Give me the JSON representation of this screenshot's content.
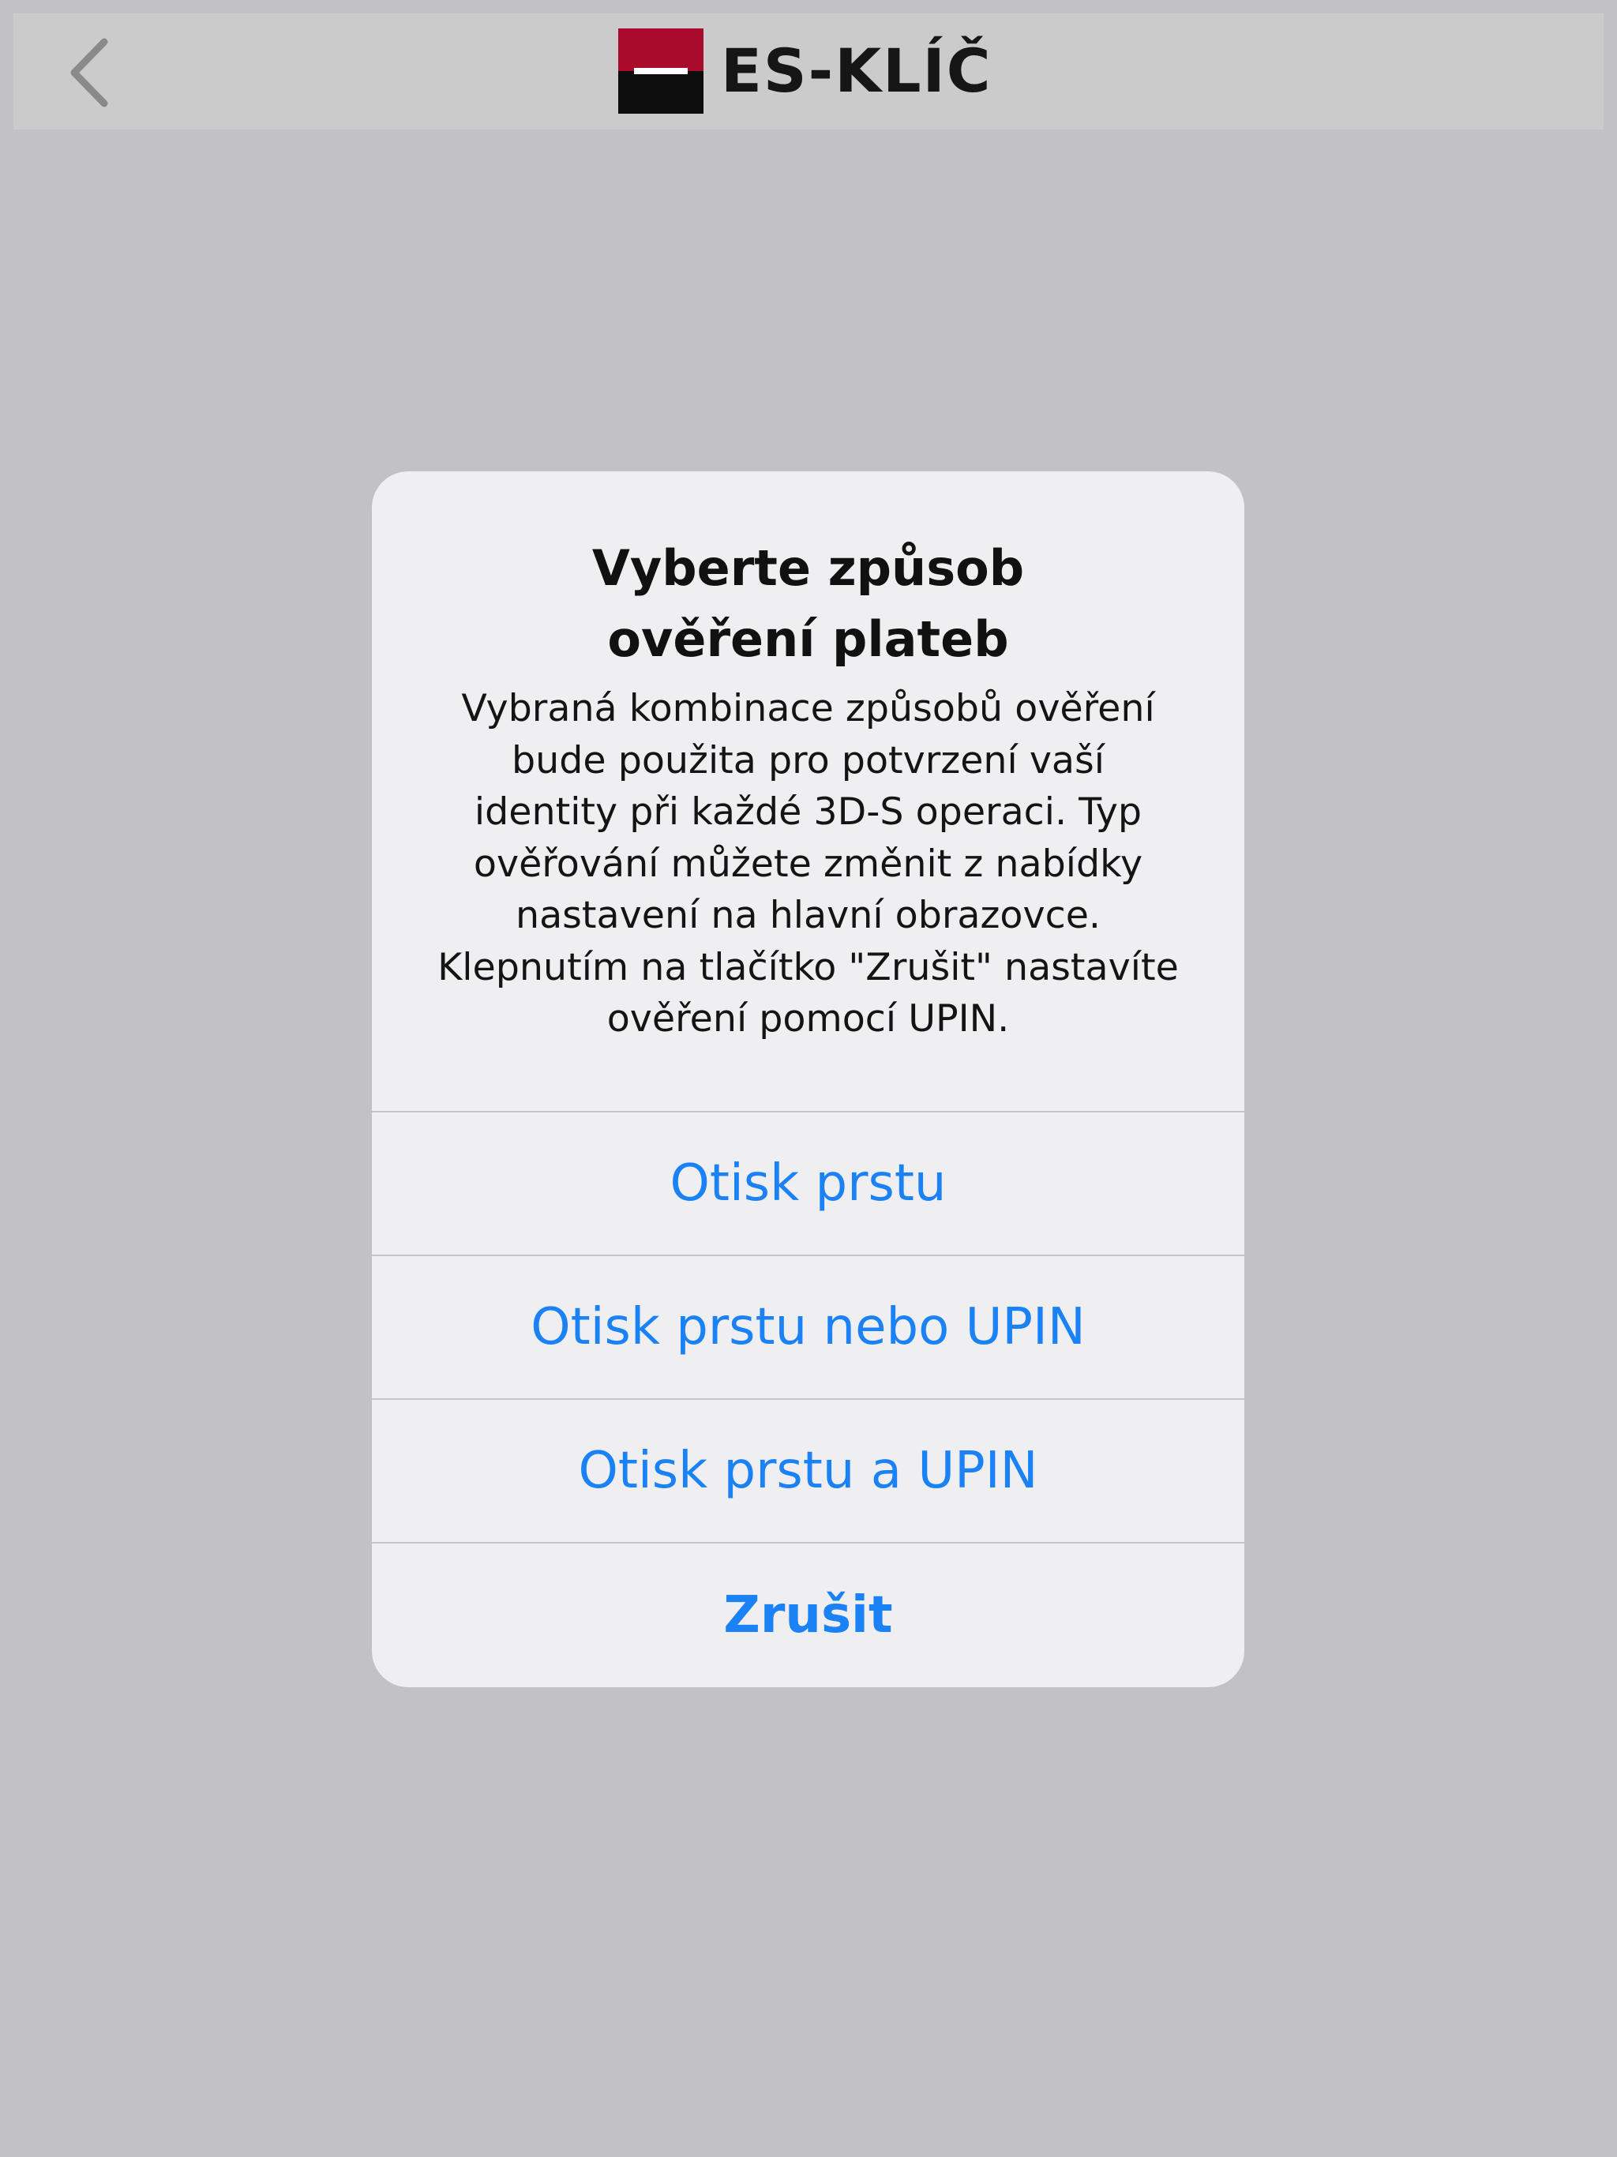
{
  "nav": {
    "back_icon": "chevron-left-icon",
    "logo_text": "ES-KLÍČ",
    "logo_colors": {
      "top": "#a80b2b",
      "bottom": "#0e0e0e",
      "bar": "#ffffff"
    }
  },
  "alert": {
    "title_lines": [
      "Vyberte způsob",
      "ověření plateb"
    ],
    "message_lines": [
      "Vybraná kombinace způsobů ověření",
      "bude použita pro potvrzení vaší",
      "identity při každé 3D-S operaci. Typ",
      "ověřování můžete změnit z nabídky",
      "nastavení na hlavní obrazovce.",
      "Klepnutím na tlačítko \"Zrušit\" nastavíte",
      "ověření pomocí UPIN."
    ],
    "actions": [
      {
        "label": "Otisk prstu"
      },
      {
        "label": "Otisk prstu nebo UPIN"
      },
      {
        "label": "Otisk prstu a UPIN"
      },
      {
        "label": "Zrušit"
      }
    ]
  },
  "colors": {
    "background": "#c2c1c6",
    "nav_bar": "#cbcbcc",
    "alert_bg": "#efeff1",
    "action_blue": "#1a82f5"
  }
}
